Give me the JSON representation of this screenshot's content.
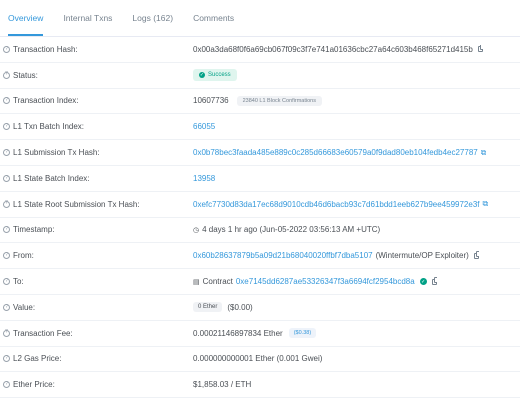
{
  "tabs": [
    "Overview",
    "Internal Txns",
    "Logs (162)",
    "Comments"
  ],
  "rows": {
    "tx_hash": {
      "label": "Transaction Hash:",
      "value": "0x00a3da68f0f6a69cb067f09c3f7e741a01636cbc27a64c603b468f65271d415b"
    },
    "status": {
      "label": "Status:",
      "value": "Success"
    },
    "tx_index": {
      "label": "Transaction Index:",
      "value": "10607736",
      "badge": "23840 L1 Block Confirmations"
    },
    "l1_batch": {
      "label": "L1 Txn Batch Index:",
      "value": "66055"
    },
    "l1_sub_hash": {
      "label": "L1 Submission Tx Hash:",
      "value": "0x0b78bec3faada485e889c0c285d66683e60579a0f9dad80eb104fedb4ec27787"
    },
    "l1_state_batch": {
      "label": "L1 State Batch Index:",
      "value": "13958"
    },
    "l1_state_root": {
      "label": "L1 State Root Submission Tx Hash:",
      "value": "0xefc7730d83da17ec68d9010cdb46d6bacb93c7d61bdd1eeb627b9ee459972e3f"
    },
    "timestamp": {
      "label": "Timestamp:",
      "value": "4 days 1 hr ago (Jun-05-2022 03:56:13 AM +UTC)"
    },
    "from": {
      "label": "From:",
      "value": "0x60b28637879b5a09d21b68040020ffbf7dba5107",
      "note": "(Wintermute/OP Exploiter)"
    },
    "to": {
      "label": "To:",
      "prefix": "Contract",
      "value": "0xe7145dd6287ae53326347f3a6694fcf2954bcd8a"
    },
    "val": {
      "label": "Value:",
      "badge": "0 Ether",
      "usd": "($0.00)"
    },
    "fee": {
      "label": "Transaction Fee:",
      "value": "0.00021146897834 Ether",
      "badge": "($0.38)"
    },
    "gas_price": {
      "label": "L2 Gas Price:",
      "value": "0.000000000001 Ether (0.001 Gwei)"
    },
    "ether_price": {
      "label": "Ether Price:",
      "value": "$1,858.03 / ETH"
    }
  },
  "icons": {
    "help": "question-circle",
    "copy": "copy",
    "external": "external-link",
    "clock": "clock",
    "contract": "file-contract",
    "verified": "check-circle"
  },
  "colors": {
    "accent": "#3498db",
    "success": "#00a186"
  }
}
